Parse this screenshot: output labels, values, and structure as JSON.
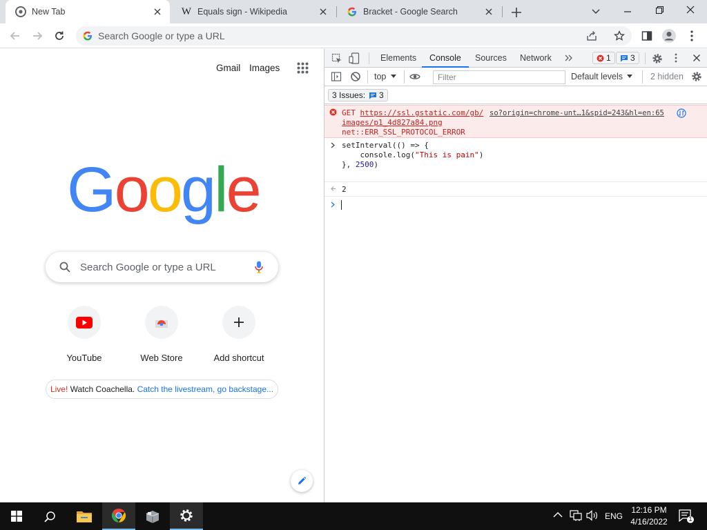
{
  "tabs": [
    {
      "title": "New Tab",
      "active": true
    },
    {
      "title": "Equals sign - Wikipedia",
      "active": false
    },
    {
      "title": "Bracket - Google Search",
      "active": false
    }
  ],
  "omnibox": {
    "placeholder": "Search Google or type a URL"
  },
  "ntp": {
    "gmail": "Gmail",
    "images": "Images",
    "search_placeholder": "Search Google or type a URL",
    "shortcuts": [
      {
        "label": "YouTube"
      },
      {
        "label": "Web Store"
      },
      {
        "label": "Add shortcut"
      }
    ],
    "promo": {
      "live": "Live!",
      "text": " Watch Coachella. ",
      "link": "Catch the livestream, go backstage..."
    }
  },
  "devtools": {
    "tabs": [
      "Elements",
      "Console",
      "Sources",
      "Network"
    ],
    "active_tab": "Console",
    "errors_count": "1",
    "messages_count": "3",
    "context": "top",
    "filter_placeholder": "Filter",
    "levels": "Default levels",
    "hidden": "2 hidden",
    "issues_label": "3 Issues:",
    "issues_count": "3",
    "error": {
      "method": "GET",
      "url_line1": "https://ssl.gstatic.com/gb/",
      "url_line2": "images/p1_4d827a84.png",
      "source": "so?origin=chrome-unt…1&spid=243&hl=en:65",
      "message": "net::ERR_SSL_PROTOCOL_ERROR"
    },
    "code": {
      "line1": "setInterval(() => {",
      "line2a": "    console.log(",
      "line2b": "\"This is pain\"",
      "line2c": ")",
      "line3a": "}, ",
      "line3b": "2500",
      "line3c": ")"
    },
    "result": "2"
  },
  "taskbar": {
    "lang": "ENG",
    "time": "12:16 PM",
    "date": "4/16/2022",
    "notif_count": "1"
  },
  "colors": {
    "google_blue": "#4285f4",
    "google_red": "#ea4335",
    "google_yellow": "#fbbc05",
    "google_green": "#34a853",
    "devtools_accent": "#1a73e8",
    "error_red": "#c5221f"
  }
}
